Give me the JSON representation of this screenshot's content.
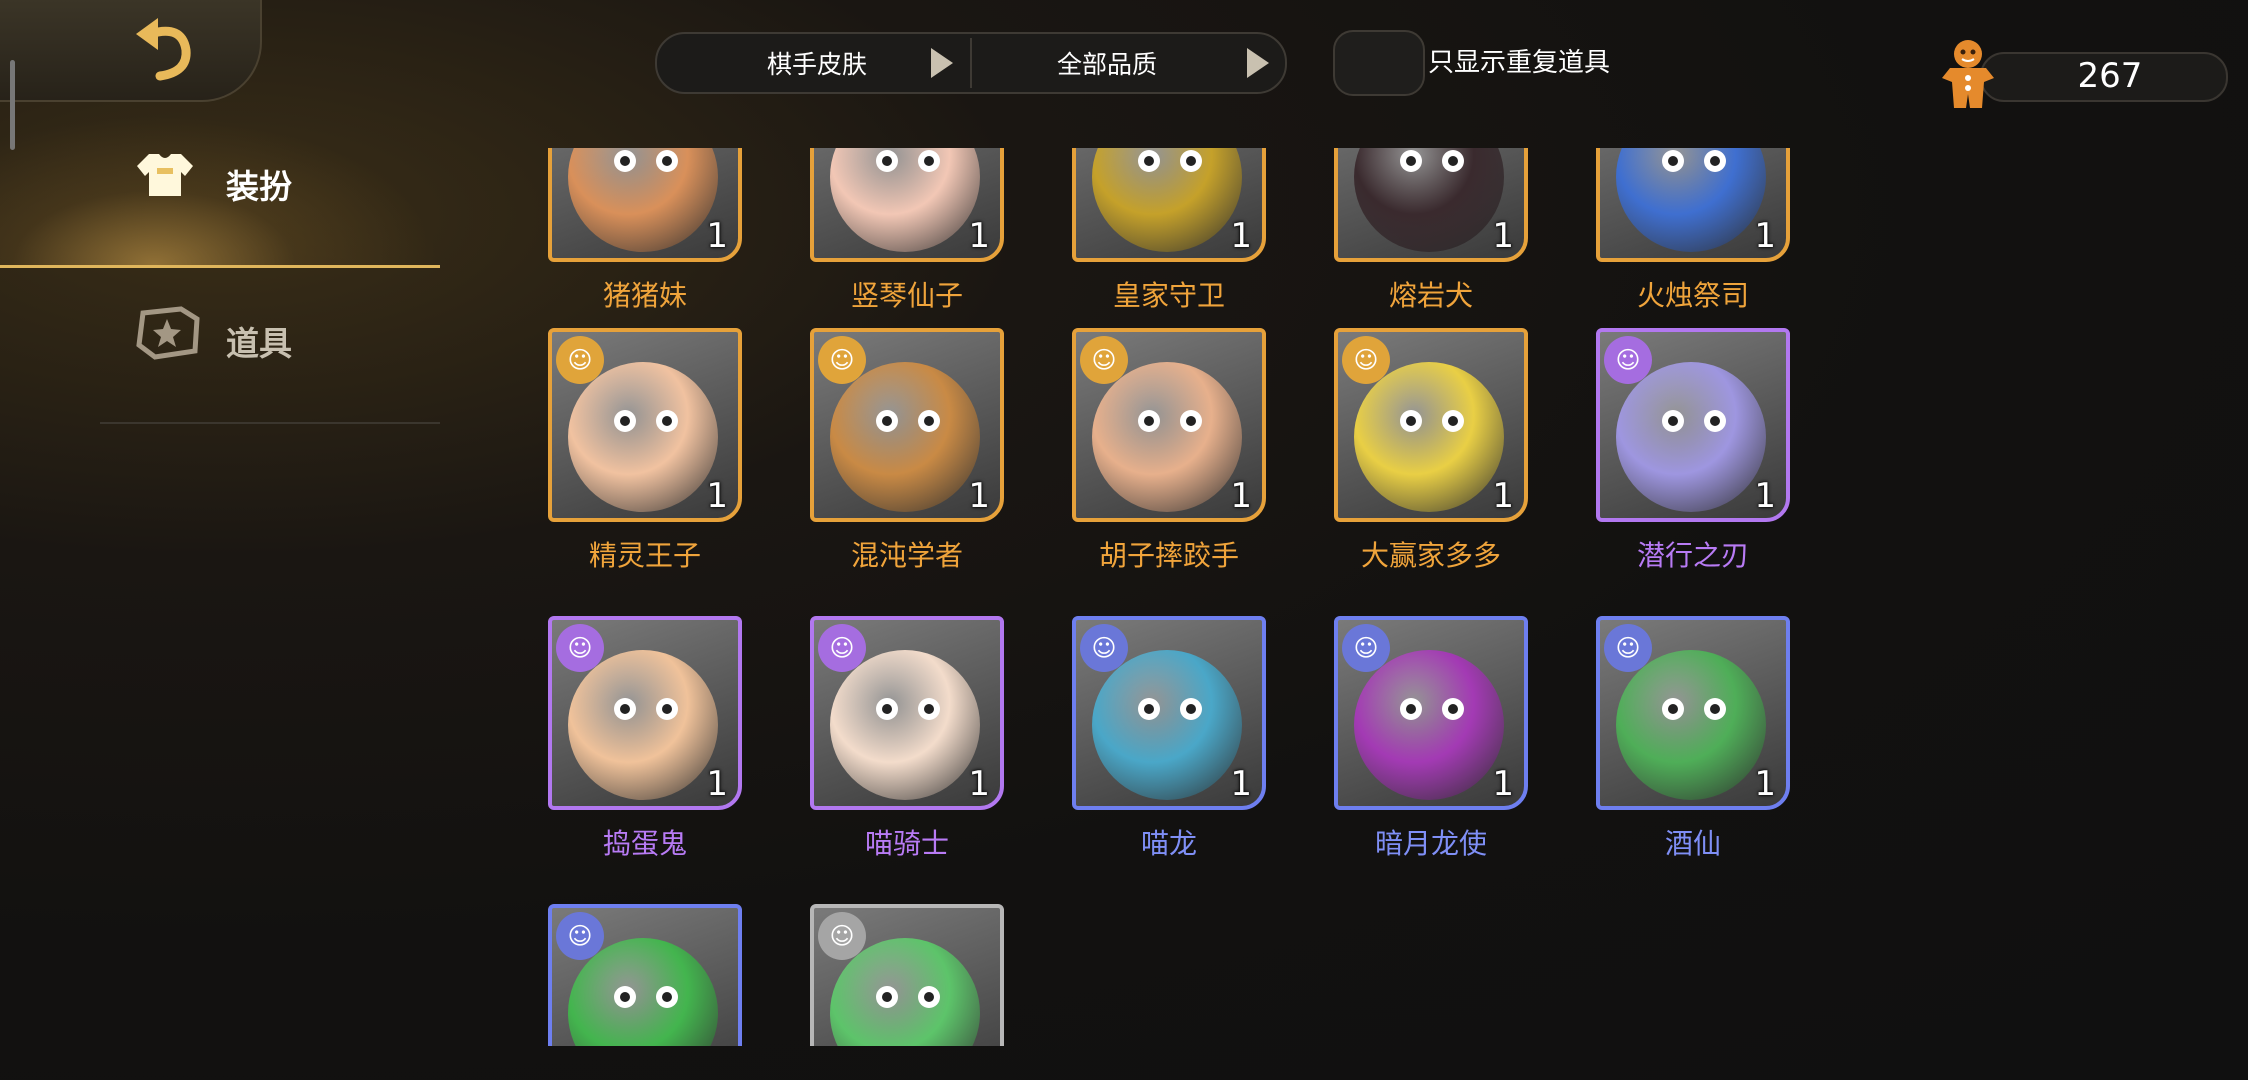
{
  "sidebar": {
    "items": [
      {
        "label": "装扮",
        "icon": "shirt-icon",
        "active": true
      },
      {
        "label": "道具",
        "icon": "items-icon",
        "active": false
      }
    ]
  },
  "filters": {
    "category": "棋手皮肤",
    "quality": "全部品质",
    "toggle_label": "只显示重复道具"
  },
  "currency": {
    "value": "267",
    "icon": "gingerbread-icon"
  },
  "cards": [
    {
      "name": "猪猪妹",
      "count": "1",
      "quality": "gold",
      "color": "#d9905a"
    },
    {
      "name": "竖琴仙子",
      "count": "1",
      "quality": "gold",
      "color": "#f2c7b5"
    },
    {
      "name": "皇家守卫",
      "count": "1",
      "quality": "gold",
      "color": "#c5a12a"
    },
    {
      "name": "熔岩犬",
      "count": "1",
      "quality": "gold",
      "color": "#3a2a2e"
    },
    {
      "name": "火烛祭司",
      "count": "1",
      "quality": "gold",
      "color": "#3f6fd0"
    },
    {
      "name": "精灵王子",
      "count": "1",
      "quality": "gold",
      "color": "#f1c2a0"
    },
    {
      "name": "混沌学者",
      "count": "1",
      "quality": "gold",
      "color": "#c98a45"
    },
    {
      "name": "胡子摔跤手",
      "count": "1",
      "quality": "gold",
      "color": "#e7b08c"
    },
    {
      "name": "大赢家多多",
      "count": "1",
      "quality": "gold",
      "color": "#e9cf45"
    },
    {
      "name": "潜行之刃",
      "count": "1",
      "quality": "purple",
      "color": "#9e96e0"
    },
    {
      "name": "捣蛋鬼",
      "count": "1",
      "quality": "purple",
      "color": "#f0c29a"
    },
    {
      "name": "喵骑士",
      "count": "1",
      "quality": "purple",
      "color": "#f3dccb"
    },
    {
      "name": "喵龙",
      "count": "1",
      "quality": "blue",
      "color": "#4aa7c8"
    },
    {
      "name": "暗月龙使",
      "count": "1",
      "quality": "blue",
      "color": "#a33ab4"
    },
    {
      "name": "酒仙",
      "count": "1",
      "quality": "blue",
      "color": "#4fae58"
    },
    {
      "name": "",
      "count": "",
      "quality": "blue",
      "color": "#43b54e"
    },
    {
      "name": "",
      "count": "",
      "quality": "gray",
      "color": "#5dc46a"
    }
  ]
}
